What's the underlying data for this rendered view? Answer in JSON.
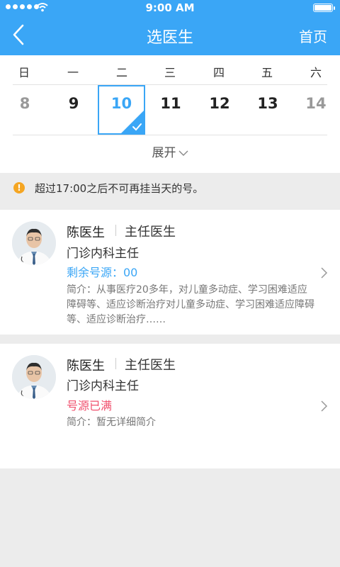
{
  "status_bar": {
    "time": "9:00 AM"
  },
  "header": {
    "title": "选医生",
    "home_label": "首页"
  },
  "calendar": {
    "weekdays": [
      "日",
      "一",
      "二",
      "三",
      "四",
      "五",
      "六"
    ],
    "dates": [
      "8",
      "9",
      "10",
      "11",
      "12",
      "13",
      "14"
    ],
    "selected_date": "10",
    "expand_label": "展开"
  },
  "notice": {
    "text": "超过17:00之后不可再挂当天的号。"
  },
  "doctors": [
    {
      "name": "陈医生",
      "rank": "主任医生",
      "department": "门诊内科主任",
      "availability": "剩余号源：00",
      "availability_color": "#3aa6f6",
      "intro": "简介：从事医疗20多年，对儿童多动症、学习困难适应障碍等、适应诊断治疗对儿童多动症、学习困难适应障碍等、适应诊断治疗……"
    },
    {
      "name": "陈医生",
      "rank": "主任医生",
      "department": "门诊内科主任",
      "availability": "号源已满",
      "availability_color": "#f0506e",
      "intro": "简介：暂无详细简介"
    }
  ],
  "colors": {
    "accent": "#3aa6f6",
    "warning": "#f5a623",
    "full": "#f0506e"
  }
}
